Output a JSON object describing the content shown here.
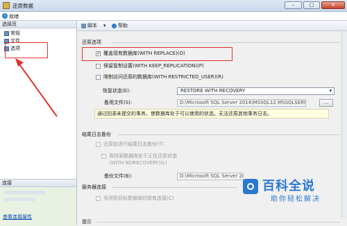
{
  "window": {
    "title": "还原数据",
    "min": "–",
    "max": "□",
    "close": "✕"
  },
  "status": {
    "ready": "就绪"
  },
  "left": {
    "select_page_header": "选择页",
    "nav": [
      {
        "label": "常规"
      },
      {
        "label": "文件"
      },
      {
        "label": "选项"
      }
    ],
    "connection_header": "连接",
    "view_conn_props": "查看连接属性"
  },
  "toolbar": {
    "script_label": "脚本",
    "script_arrow": "▾",
    "help_label": "帮助"
  },
  "restore_options": {
    "header": "还原选项",
    "overwrite": "覆盖现有数据库(WITH REPLACE)(O)",
    "keep_replication": "保留复制设置(WITH KEEP_REPLICATION)(P)",
    "restricted_user": "限制访问还原的数据库(WITH RESTRICTED_USER)(R)",
    "recovery_state_label": "恢复状态(E):",
    "recovery_state_value": "RESTORE WITH RECOVERY",
    "standby_file_label": "备用文件(S):",
    "standby_file_value": "D:\\Microsoft SQL Server 2014\\MSSQL12.MSSQLSERVER",
    "info_text": "通过回滚未提交的事务，使数据库处于可以使用的状态。无法还原其他事务日志。"
  },
  "tail_log": {
    "header": "结尾日志备份",
    "do_tail_backup": "还原前进行结尾日志备份(T)",
    "leave_restoring": "保持源数据库处于正在还原状态",
    "leave_restoring_sub": "(WITH NORECOVERY)(L)",
    "backup_file_label": "备份文件(B):",
    "backup_file_value": "D:\\Microsoft SQL Server 2014\\M"
  },
  "server_conn": {
    "header": "服务器连接",
    "close_existing": "关闭到目标数据库的现有连接(C)"
  },
  "prompt": {
    "header": "提示"
  },
  "browse_label": "...",
  "watermark": {
    "main": "百科全说",
    "sub": "助你轻松解决"
  },
  "colors": {
    "annotation": "#e0312b",
    "watermark": "#2b78d0",
    "info_bg": "#ffffe1"
  }
}
